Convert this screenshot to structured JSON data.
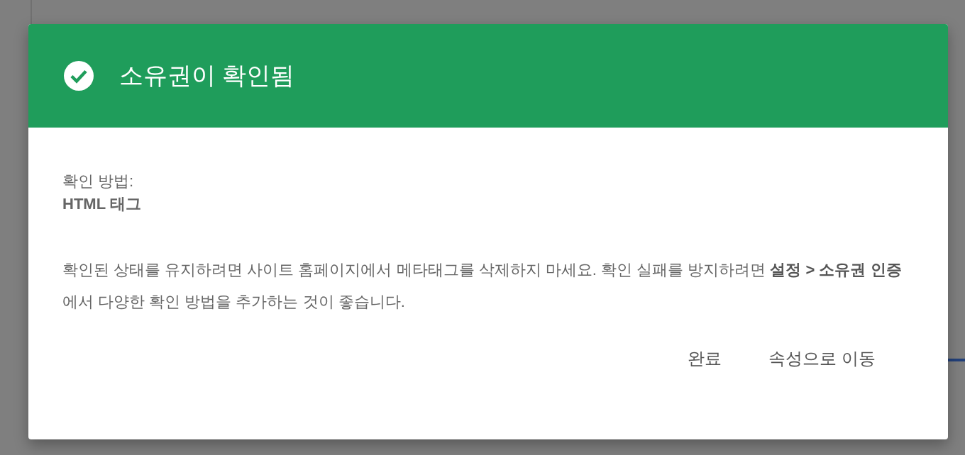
{
  "dialog": {
    "title": "소유권이 확인됨",
    "method_label": "확인 방법:",
    "method_value": "HTML 태그",
    "message": "확인된 상태를 유지하려면 사이트 홈페이지에서 메타태그를 삭제하지 마세요. 확인 실패를 방지하려면 **설정 > 소유권 인증**에서 다양한 확인 방법을 추가하는 것이 좋습니다.",
    "buttons": [
      "완료",
      "속성으로 이동"
    ]
  }
}
